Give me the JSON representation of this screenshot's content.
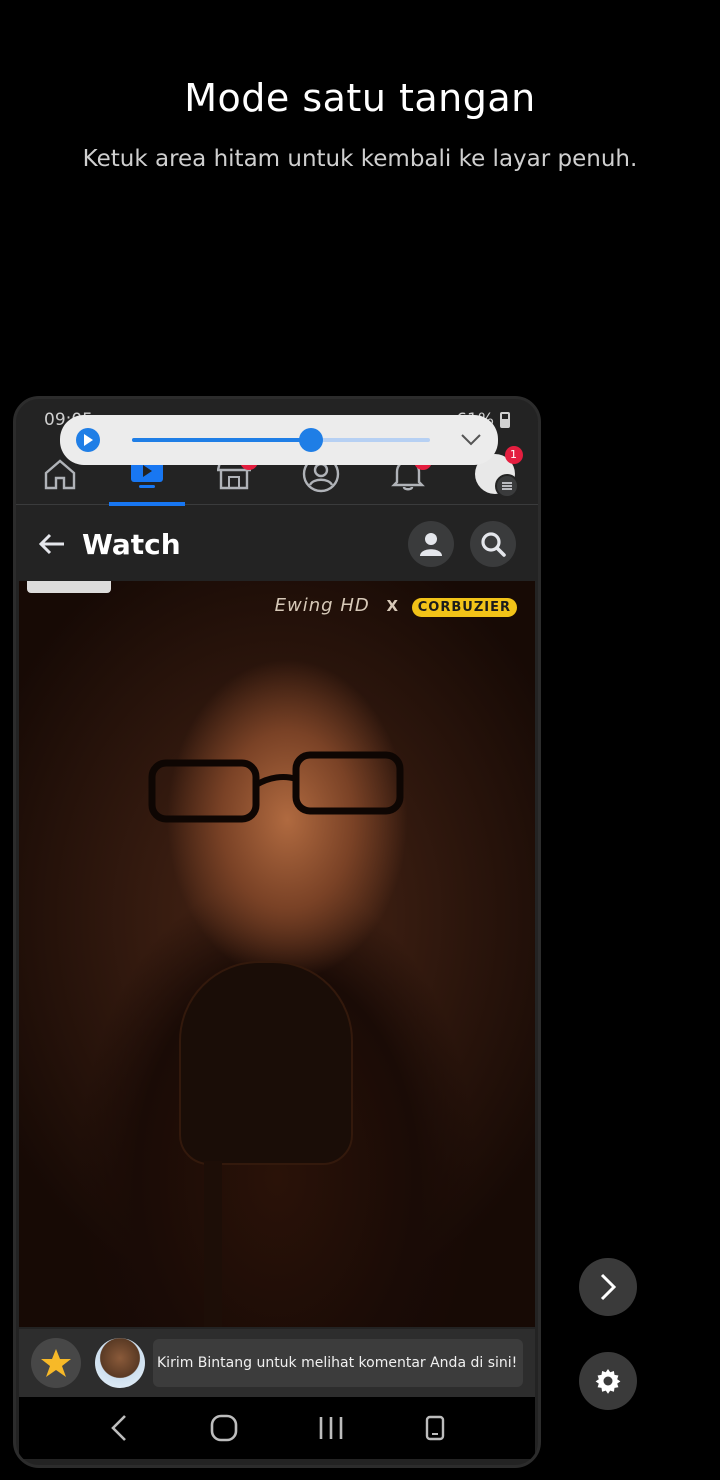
{
  "one_hand_mode": {
    "title": "Mode satu tangan",
    "subtitle": "Ketuk area hitam untuk kembali ke layar penuh."
  },
  "status_bar": {
    "time": "09:05",
    "battery": "61%"
  },
  "media_player": {
    "progress_fraction": 0.6,
    "accent_color": "#1f7ee6"
  },
  "fb_nav": {
    "items": [
      {
        "icon": "home-icon"
      },
      {
        "icon": "watch-icon",
        "active": true
      },
      {
        "icon": "marketplace-icon",
        "badge": "2"
      },
      {
        "icon": "profile-icon"
      },
      {
        "icon": "bell-icon",
        "badge": "9"
      },
      {
        "icon": "menu-avatar",
        "badge": "1"
      }
    ]
  },
  "watch_header": {
    "title": "Watch"
  },
  "video": {
    "watermark": "Ewing HD",
    "separator": "X",
    "logo_text": "CORBUZIER"
  },
  "comment_bar": {
    "placeholder": "Kirim Bintang untuk melihat komentar Anda di sini!"
  },
  "colors": {
    "facebook_blue": "#1877f2",
    "badge_red": "#e41e3f",
    "background": "#000000",
    "app_surface": "#232323"
  }
}
